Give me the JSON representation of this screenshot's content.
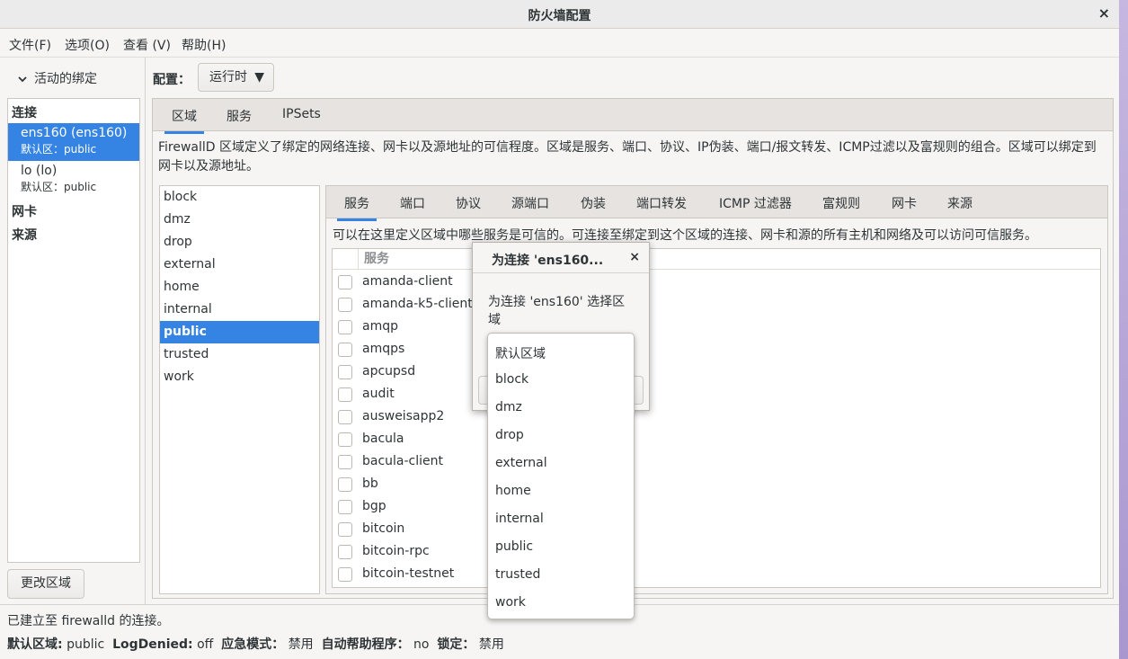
{
  "window": {
    "title": "防火墙配置"
  },
  "menu": [
    "文件(F)",
    "选项(O)",
    "查看 (V)",
    "帮助(H)"
  ],
  "left": {
    "header": "活动的绑定",
    "categories": {
      "connections": "连接",
      "nic": "网卡",
      "sources": "来源"
    },
    "connections": [
      {
        "name": "ens160 (ens160)",
        "zone": "默认区：public"
      },
      {
        "name": "lo (lo)",
        "zone": "默认区：public"
      }
    ],
    "change_zone_button": "更改区域"
  },
  "config": {
    "label": "配置：",
    "value": "运行时"
  },
  "top_tabs": [
    "区域",
    "服务",
    "IPSets"
  ],
  "zone_description": "FirewallD 区域定义了绑定的网络连接、网卡以及源地址的可信程度。区域是服务、端口、协议、IP伪装、端口/报文转发、ICMP过滤以及富规则的组合。区域可以绑定到网卡以及源地址。",
  "zones": [
    "block",
    "dmz",
    "drop",
    "external",
    "home",
    "internal",
    "public",
    "trusted",
    "work"
  ],
  "selected_zone": "public",
  "zone_tabs": [
    "服务",
    "端口",
    "协议",
    "源端口",
    "伪装",
    "端口转发",
    "ICMP 过滤器",
    "富规则",
    "网卡",
    "来源"
  ],
  "services_description": "可以在这里定义区域中哪些服务是可信的。可连接至绑定到这个区域的连接、网卡和源的所有主机和网络及可以访问可信服务。",
  "services_column": "服务",
  "services": [
    "amanda-client",
    "amanda-k5-client",
    "amqp",
    "amqps",
    "apcupsd",
    "audit",
    "ausweisapp2",
    "bacula",
    "bacula-client",
    "bb",
    "bgp",
    "bitcoin",
    "bitcoin-rpc",
    "bitcoin-testnet"
  ],
  "status": {
    "connection": "已建立至 firewalld 的连接。",
    "default_zone_label": "默认区域:",
    "default_zone_value": "public",
    "logdenied_label": "LogDenied:",
    "logdenied_value": "off",
    "panic_label": "应急模式：",
    "panic_value": "禁用",
    "helper_label": "自动帮助程序：",
    "helper_value": "no",
    "lockdown_label": "锁定：",
    "lockdown_value": "禁用"
  },
  "dialog": {
    "title": "为连接 'ens160...",
    "message": "为连接 'ens160' 选择区域",
    "options": [
      "默认区域",
      "block",
      "dmz",
      "drop",
      "external",
      "home",
      "internal",
      "public",
      "trusted",
      "work"
    ]
  },
  "colors": {
    "accent": "#3584e4",
    "window_bg": "#f6f5f4"
  }
}
